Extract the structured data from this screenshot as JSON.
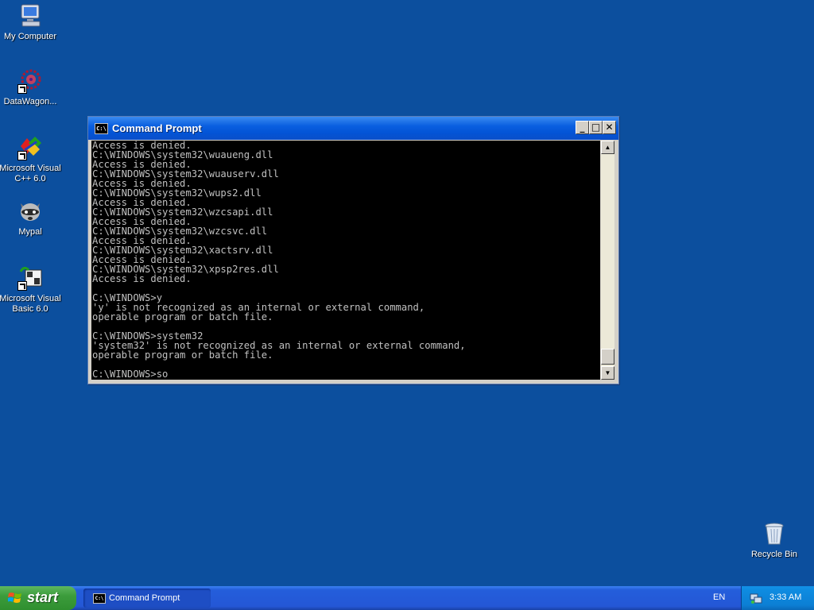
{
  "desktop": {
    "icons": [
      {
        "label": "My Computer"
      },
      {
        "label": "DataWagon..."
      },
      {
        "label": "Microsoft Visual C++ 6.0"
      },
      {
        "label": "Mypal"
      },
      {
        "label": "Microsoft Visual Basic 6.0"
      },
      {
        "label": "Recycle Bin"
      }
    ]
  },
  "window": {
    "title": "Command Prompt",
    "icon_text": "C:\\",
    "minimize_glyph": "_",
    "maximize_glyph": "□",
    "close_glyph": "✕",
    "console_lines": [
      "Access is denied.",
      "C:\\WINDOWS\\system32\\wuaueng.dll",
      "Access is denied.",
      "C:\\WINDOWS\\system32\\wuauserv.dll",
      "Access is denied.",
      "C:\\WINDOWS\\system32\\wups2.dll",
      "Access is denied.",
      "C:\\WINDOWS\\system32\\wzcsapi.dll",
      "Access is denied.",
      "C:\\WINDOWS\\system32\\wzcsvc.dll",
      "Access is denied.",
      "C:\\WINDOWS\\system32\\xactsrv.dll",
      "Access is denied.",
      "C:\\WINDOWS\\system32\\xpsp2res.dll",
      "Access is denied.",
      "",
      "C:\\WINDOWS>y",
      "'y' is not recognized as an internal or external command,",
      "operable program or batch file.",
      "",
      "C:\\WINDOWS>system32",
      "'system32' is not recognized as an internal or external command,",
      "operable program or batch file.",
      "",
      "C:\\WINDOWS>so"
    ],
    "colors": {
      "background": "#000000",
      "text": "#c0c0c0"
    }
  },
  "taskbar": {
    "start_label": "start",
    "items": [
      {
        "label": "Command Prompt",
        "icon_text": "C:\\"
      }
    ],
    "language": "EN",
    "clock": "3:33 AM"
  }
}
